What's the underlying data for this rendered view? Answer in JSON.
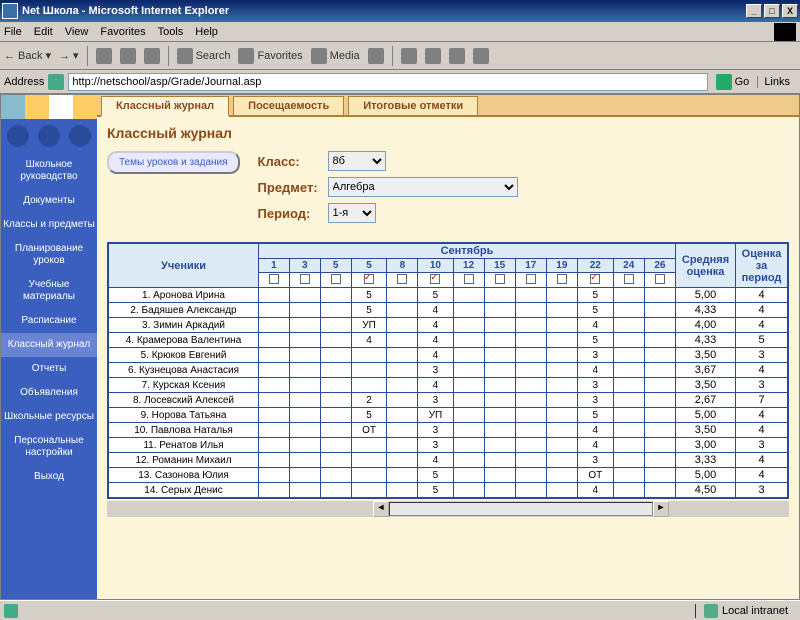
{
  "window": {
    "title": "Net Школа - Microsoft Internet Explorer"
  },
  "menu": {
    "file": "File",
    "edit": "Edit",
    "view": "View",
    "favorites": "Favorites",
    "tools": "Tools",
    "help": "Help"
  },
  "toolbar": {
    "back": "Back",
    "search": "Search",
    "favorites": "Favorites",
    "media": "Media"
  },
  "address": {
    "label": "Address",
    "url": "http://netschool/asp/Grade/Journal.asp",
    "go": "Go",
    "links": "Links"
  },
  "sidebar": {
    "items": [
      "Школьное руководство",
      "Документы",
      "Классы и предметы",
      "Планирование уроков",
      "Учебные материалы",
      "Расписание",
      "Классный журнал",
      "Отчеты",
      "Объявления",
      "Школьные ресурсы",
      "Персональные настройки",
      "Выход"
    ],
    "activeIndex": 6
  },
  "tabs": {
    "t1": "Классный журнал",
    "t2": "Посещаемость",
    "t3": "Итоговые отметки"
  },
  "page": {
    "title": "Классный журнал",
    "topicBtn": "Темы уроков и задания",
    "classLbl": "Класс:",
    "classVal": "8б",
    "subjLbl": "Предмет:",
    "subjVal": "Алгебра",
    "perLbl": "Период:",
    "perVal": "1-я"
  },
  "table": {
    "studentsH": "Ученики",
    "monthH": "Сентябрь",
    "avgH": "Средняя оценка",
    "periodH": "Оценка за период",
    "dates": [
      "1",
      "3",
      "5",
      "5",
      "8",
      "10",
      "12",
      "15",
      "17",
      "19",
      "22",
      "24",
      "26"
    ],
    "checked": [
      false,
      false,
      false,
      true,
      false,
      true,
      false,
      false,
      false,
      false,
      true,
      false,
      false
    ],
    "rows": [
      {
        "n": "1. Аронова Ирина",
        "c": [
          "",
          "",
          "",
          "5",
          "",
          "5",
          "",
          "",
          "",
          "",
          "5",
          "",
          ""
        ],
        "avg": "5,00",
        "per": "4"
      },
      {
        "n": "2. Бадяшев Александр",
        "c": [
          "",
          "",
          "",
          "5",
          "",
          "4",
          "",
          "",
          "",
          "",
          "5",
          "",
          ""
        ],
        "avg": "4,33",
        "per": "4"
      },
      {
        "n": "3. Зимин Аркадий",
        "c": [
          "",
          "",
          "",
          "УП",
          "",
          "4",
          "",
          "",
          "",
          "",
          "4",
          "",
          ""
        ],
        "avg": "4,00",
        "per": "4"
      },
      {
        "n": "4. Крамерова Валентина",
        "c": [
          "",
          "",
          "",
          "4",
          "",
          "4",
          "",
          "",
          "",
          "",
          "5",
          "",
          ""
        ],
        "avg": "4,33",
        "per": "5"
      },
      {
        "n": "5. Крюков Евгений",
        "c": [
          "",
          "",
          "",
          "",
          "",
          "4",
          "",
          "",
          "",
          "",
          "3",
          "",
          ""
        ],
        "avg": "3,50",
        "per": "3"
      },
      {
        "n": "6. Кузнецова Анастасия",
        "c": [
          "",
          "",
          "",
          "",
          "",
          "3",
          "",
          "",
          "",
          "",
          "4",
          "",
          ""
        ],
        "avg": "3,67",
        "per": "4"
      },
      {
        "n": "7. Курская Ксения",
        "c": [
          "",
          "",
          "",
          "",
          "",
          "4",
          "",
          "",
          "",
          "",
          "3",
          "",
          ""
        ],
        "avg": "3,50",
        "per": "3"
      },
      {
        "n": "8. Лосевский Алексей",
        "c": [
          "",
          "",
          "",
          "2",
          "",
          "3",
          "",
          "",
          "",
          "",
          "3",
          "",
          ""
        ],
        "avg": "2,67",
        "per": "7"
      },
      {
        "n": "9. Норова Татьяна",
        "c": [
          "",
          "",
          "",
          "5",
          "",
          "УП",
          "",
          "",
          "",
          "",
          "5",
          "",
          ""
        ],
        "avg": "5,00",
        "per": "4"
      },
      {
        "n": "10. Павлова Наталья",
        "c": [
          "",
          "",
          "",
          "ОТ",
          "",
          "3",
          "",
          "",
          "",
          "",
          "4",
          "",
          ""
        ],
        "avg": "3,50",
        "per": "4"
      },
      {
        "n": "11. Ренатов Илья",
        "c": [
          "",
          "",
          "",
          "",
          "",
          "3",
          "",
          "",
          "",
          "",
          "4",
          "",
          ""
        ],
        "avg": "3,00",
        "per": "3"
      },
      {
        "n": "12. Романин Михаил",
        "c": [
          "",
          "",
          "",
          "",
          "",
          "4",
          "",
          "",
          "",
          "",
          "3",
          "",
          ""
        ],
        "avg": "3,33",
        "per": "4"
      },
      {
        "n": "13. Сазонова Юлия",
        "c": [
          "",
          "",
          "",
          "",
          "",
          "5",
          "",
          "",
          "",
          "",
          "ОТ",
          "",
          ""
        ],
        "avg": "5,00",
        "per": "4"
      },
      {
        "n": "14. Серых Денис",
        "c": [
          "",
          "",
          "",
          "",
          "",
          "5",
          "",
          "",
          "",
          "",
          "4",
          "",
          ""
        ],
        "avg": "4,50",
        "per": "3"
      }
    ]
  },
  "status": {
    "zone": "Local intranet"
  }
}
